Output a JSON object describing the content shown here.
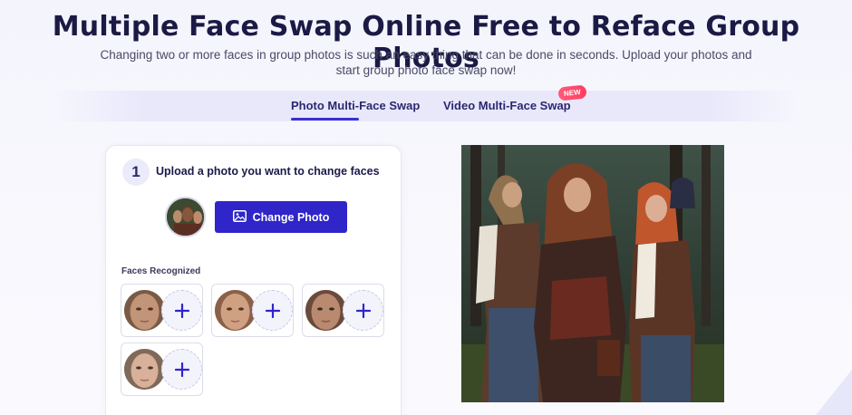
{
  "hero": {
    "title": "Multiple Face Swap Online Free to Reface Group Photos",
    "subtitle_line1": "Changing two or more faces in group photos is such an easy thing that can be done in seconds. Upload your photos and",
    "subtitle_line2": "start group photo face swap now!"
  },
  "tabs": [
    {
      "label": "Photo Multi-Face Swap",
      "active": true
    },
    {
      "label": "Video Multi-Face Swap",
      "active": false,
      "badge": "NEW"
    }
  ],
  "upload": {
    "step_number": "1",
    "step_label": "Upload a photo you want to change faces",
    "change_button_label": "Change Photo"
  },
  "faces": {
    "label": "Faces Recognized",
    "count": 4
  },
  "colors": {
    "accent": "#2f25c9",
    "badge": "#ff3d5e",
    "title": "#1b1a45"
  },
  "icons": {
    "change_photo": "image-icon",
    "add_face": "plus-icon"
  }
}
